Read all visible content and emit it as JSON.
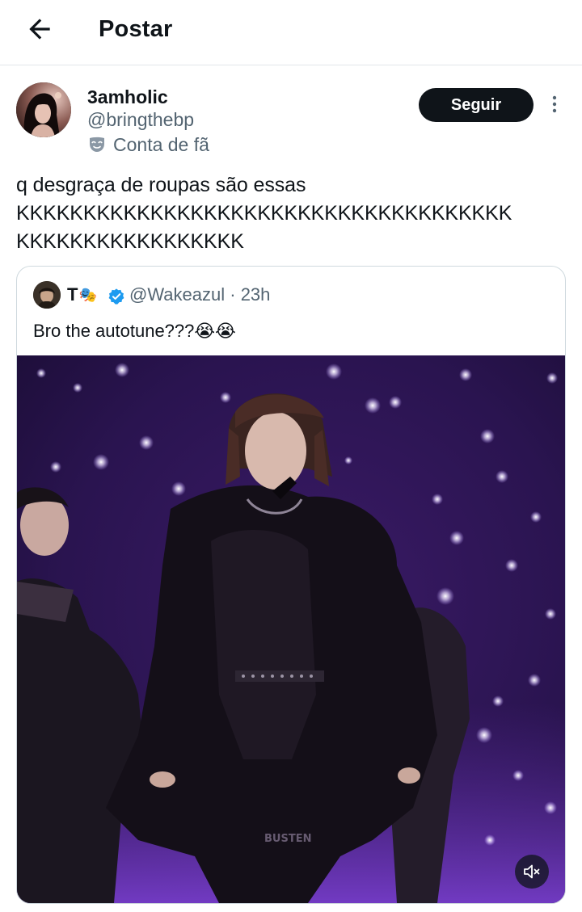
{
  "header": {
    "title": "Postar",
    "back_icon": "arrow-left-icon"
  },
  "post": {
    "author_name": "3amholic",
    "author_handle": "@bringthebp",
    "fan_label": "Conta de fã",
    "fan_icon": "theater-mask-icon",
    "follow_label": "Seguir",
    "more_icon": "more-vertical-icon",
    "text_lines": [
      "q desgraça de roupas são essas",
      "KKKKKKKKKKKKKKKKKKKKKKKKKKKKKKKKKKKKK",
      "KKKKKKKKKKKKKKKKK"
    ]
  },
  "quote": {
    "author_name": "T",
    "author_emoji": "🎭",
    "verified_icon": "verified-badge-icon",
    "author_handle": "@Wakeazul",
    "time": "· 23h",
    "text": "Bro the autotune???😭😭",
    "media_watermark": "BUSTEN",
    "mute_icon": "volume-muted-icon"
  },
  "colors": {
    "text_primary": "#0f1419",
    "text_secondary": "#536471",
    "border": "#cfd9de",
    "button_bg": "#0f1419",
    "verified": "#1d9bf0",
    "stage_purple": "#5a2a9a"
  }
}
